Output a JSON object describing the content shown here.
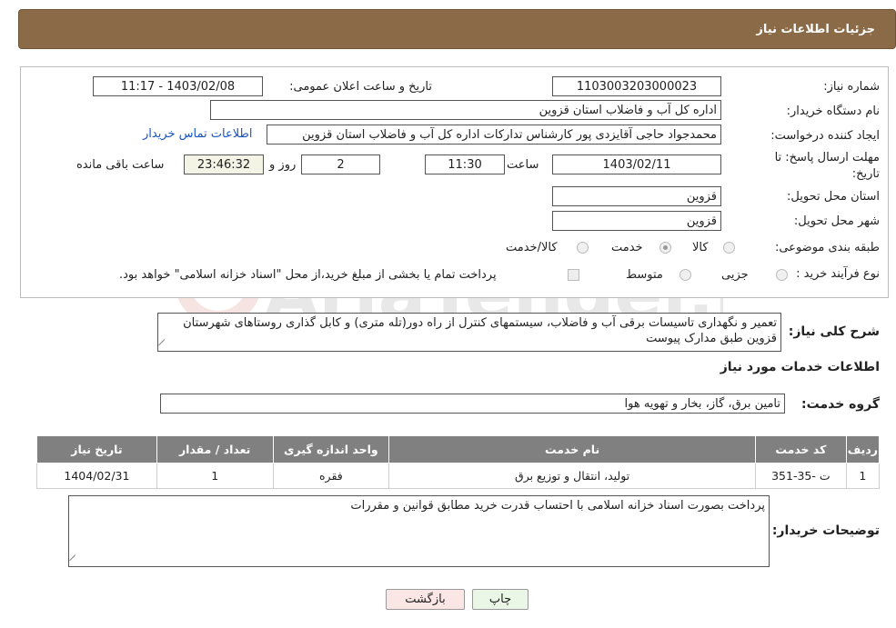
{
  "header": {
    "title": "جزئیات اطلاعات نیاز"
  },
  "form": {
    "need_number": {
      "label": "شماره نیاز:",
      "value": "1103003203000023"
    },
    "announce_datetime": {
      "label": "تاریخ و ساعت اعلان عمومی:",
      "value": "1403/02/08 - 11:17"
    },
    "buyer_org": {
      "label": "نام دستگاه خریدار:",
      "value": "اداره کل آب و فاضلاب استان قزوین"
    },
    "requester": {
      "label": "ایجاد کننده درخواست:",
      "value": "محمدجواد حاجی آقایزدی پور کارشناس تدارکات اداره کل آب و فاضلاب استان قزوین",
      "contact_link": "اطلاعات تماس خریدار"
    },
    "deadline": {
      "label": "مهلت ارسال پاسخ: تا تاریخ:",
      "date": "1403/02/11",
      "time_label": "ساعت",
      "time": "11:30",
      "days": "2",
      "days_label": "روز و",
      "remaining": "23:46:32",
      "remaining_label": "ساعت باقی مانده"
    },
    "delivery_province": {
      "label": "استان محل تحویل:",
      "value": "قزوین"
    },
    "delivery_city": {
      "label": "شهر محل تحویل:",
      "value": "قزوین"
    },
    "category": {
      "label": "طبقه بندی موضوعی:",
      "options": [
        "کالا",
        "خدمت",
        "کالا/خدمت"
      ],
      "selected": "خدمت"
    },
    "purchase_type": {
      "label": "نوع فرآیند خرید :",
      "options": [
        "جزیی",
        "متوسط"
      ],
      "selected": "",
      "note": "پرداخت تمام یا بخشی از مبلغ خرید،از محل \"اسناد خزانه اسلامی\" خواهد بود."
    }
  },
  "description": {
    "label": "شرح کلی نیاز:",
    "value": "تعمیر و نگهداری تاسیسات برقی آب و فاضلاب، سیستمهای کنترل از راه دور(تله متری) و کابل گذاری روستاهای شهرستان قزوین طبق مدارک پیوست"
  },
  "services_section": {
    "title": "اطلاعات خدمات مورد نیاز",
    "group_label": "گروه خدمت:",
    "group_value": "تامین برق، گاز، بخار و تهویه هوا",
    "table": {
      "headers": [
        "ردیف",
        "کد خدمت",
        "نام خدمت",
        "واحد اندازه گیری",
        "تعداد / مقدار",
        "تاریخ نیاز"
      ],
      "rows": [
        [
          "1",
          "ت -35-351",
          "تولید، انتقال و توزیع برق",
          "فقره",
          "1",
          "1404/02/31"
        ]
      ]
    }
  },
  "buyer_notes": {
    "label": "توضیحات خریدار:",
    "value": "پرداخت بصورت اسناد خزانه اسلامی با احتساب قدرت خرید مطابق قوانین و مقررات"
  },
  "buttons": {
    "print": "چاپ",
    "back": "بازگشت"
  },
  "watermark": {
    "text": "AriaTender.net"
  },
  "colors": {
    "header_bg": "#8b6a47",
    "table_header_bg": "#808080",
    "link": "#1a55c2",
    "print_btn_bg": "#eaf7e6",
    "back_btn_bg": "#fbe6e6"
  }
}
